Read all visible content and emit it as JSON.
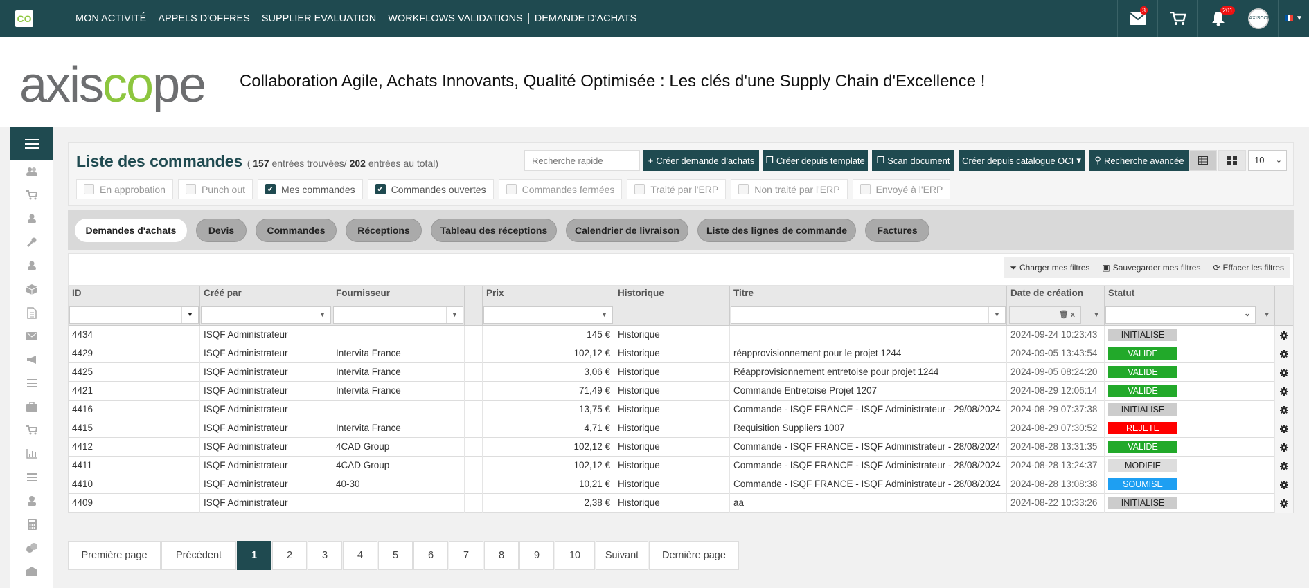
{
  "topbar": {
    "logo": "CO",
    "nav": [
      "MON ACTIVITÉ",
      "APPELS D'OFFRES",
      "SUPPLIER EVALUATION",
      "WORKFLOWS VALIDATIONS",
      "DEMANDE D'ACHATS"
    ],
    "mail_badge": "3",
    "bell_badge": "201",
    "avatar_text": "AXISCOPE"
  },
  "header": {
    "brand_a": "axis",
    "brand_b": "co",
    "brand_c": "pe",
    "tagline": "Collaboration Agile, Achats Innovants, Qualité Optimisée : Les clés d'une Supply Chain d'Excellence !"
  },
  "panel": {
    "title": "Liste des commandes",
    "count_open": "( ",
    "count_found": "157",
    "count_found_label": " entrées trouvées/ ",
    "count_total": "202",
    "count_total_label": " entrées au total)",
    "search_placeholder": "Recherche rapide",
    "buttons": {
      "create_request": "Créer demande d'achats",
      "create_template": "Créer depuis template",
      "scan": "Scan document",
      "catalog": "Créer depuis catalogue OCI",
      "advanced": "Recherche avancée"
    },
    "page_size": "10",
    "chips": [
      {
        "label": "En approbation",
        "checked": false
      },
      {
        "label": "Punch out",
        "checked": false
      },
      {
        "label": "Mes commandes",
        "checked": true
      },
      {
        "label": "Commandes ouvertes",
        "checked": true
      },
      {
        "label": "Commandes fermées",
        "checked": false
      },
      {
        "label": "Traité par l'ERP",
        "checked": false
      },
      {
        "label": "Non traité par l'ERP",
        "checked": false
      },
      {
        "label": "Envoyé à l'ERP",
        "checked": false
      }
    ]
  },
  "tabs": [
    "Demandes d'achats",
    "Devis",
    "Commandes",
    "Réceptions",
    "Tableau des réceptions",
    "Calendrier de livraison",
    "Liste des lignes de commande",
    "Factures"
  ],
  "filters": {
    "load": "Charger mes filtres",
    "save": "Sauvegarder mes filtres",
    "clear": "Effacer les filtres"
  },
  "grid": {
    "headers": [
      "ID",
      "Créé par",
      "Fournisseur",
      "",
      "Prix",
      "Historique",
      "Titre",
      "Date de création",
      "Statut"
    ],
    "date_filter_clear": "x",
    "rows": [
      [
        "4434",
        "ISQF Administrateur",
        "",
        "145 €",
        "Historique",
        "",
        "2024-09-24 10:23:43",
        "INITIALISE"
      ],
      [
        "4429",
        "ISQF Administrateur",
        "Intervita France",
        "102,12 €",
        "Historique",
        "réapprovisionnement pour le projet 1244",
        "2024-09-05 13:43:54",
        "VALIDE"
      ],
      [
        "4425",
        "ISQF Administrateur",
        "Intervita France",
        "3,06 €",
        "Historique",
        "Réapprovisionnement entretoise pour projet 1244",
        "2024-09-05 08:24:20",
        "VALIDE"
      ],
      [
        "4421",
        "ISQF Administrateur",
        "Intervita France",
        "71,49 €",
        "Historique",
        "Commande Entretoise Projet 1207",
        "2024-08-29 12:06:14",
        "VALIDE"
      ],
      [
        "4416",
        "ISQF Administrateur",
        "",
        "13,75 €",
        "Historique",
        "Commande - ISQF FRANCE - ISQF Administrateur - 29/08/2024",
        "2024-08-29 07:37:38",
        "INITIALISE"
      ],
      [
        "4415",
        "ISQF Administrateur",
        "Intervita France",
        "4,71 €",
        "Historique",
        "Requisition Suppliers 1007",
        "2024-08-29 07:30:52",
        "REJETE"
      ],
      [
        "4412",
        "ISQF Administrateur",
        "4CAD Group",
        "102,12 €",
        "Historique",
        "Commande - ISQF FRANCE - ISQF Administrateur - 28/08/2024",
        "2024-08-28 13:31:35",
        "VALIDE"
      ],
      [
        "4411",
        "ISQF Administrateur",
        "4CAD Group",
        "102,12 €",
        "Historique",
        "Commande - ISQF FRANCE - ISQF Administrateur - 28/08/2024",
        "2024-08-28 13:24:37",
        "MODIFIE"
      ],
      [
        "4410",
        "ISQF Administrateur",
        "40-30",
        "10,21 €",
        "Historique",
        "Commande - ISQF FRANCE - ISQF Administrateur - 28/08/2024",
        "2024-08-28 13:08:38",
        "SOUMISE"
      ],
      [
        "4409",
        "ISQF Administrateur",
        "",
        "2,38 €",
        "Historique",
        "aa",
        "2024-08-22 10:33:26",
        "INITIALISE"
      ]
    ]
  },
  "status_colors": {
    "INITIALISE": "#cccccc",
    "VALIDE": "#22a92a",
    "REJETE": "#ff0000",
    "MODIFIE": "#dddddd",
    "SOUMISE": "#1e9ff2"
  },
  "pager": [
    "Première page",
    "Précédent",
    "1",
    "2",
    "3",
    "4",
    "5",
    "6",
    "7",
    "8",
    "9",
    "10",
    "Suivant",
    "Dernière page"
  ],
  "pager_active": "1",
  "colors": {
    "primary": "#1f4a50",
    "brand_green": "#8dc63f"
  }
}
